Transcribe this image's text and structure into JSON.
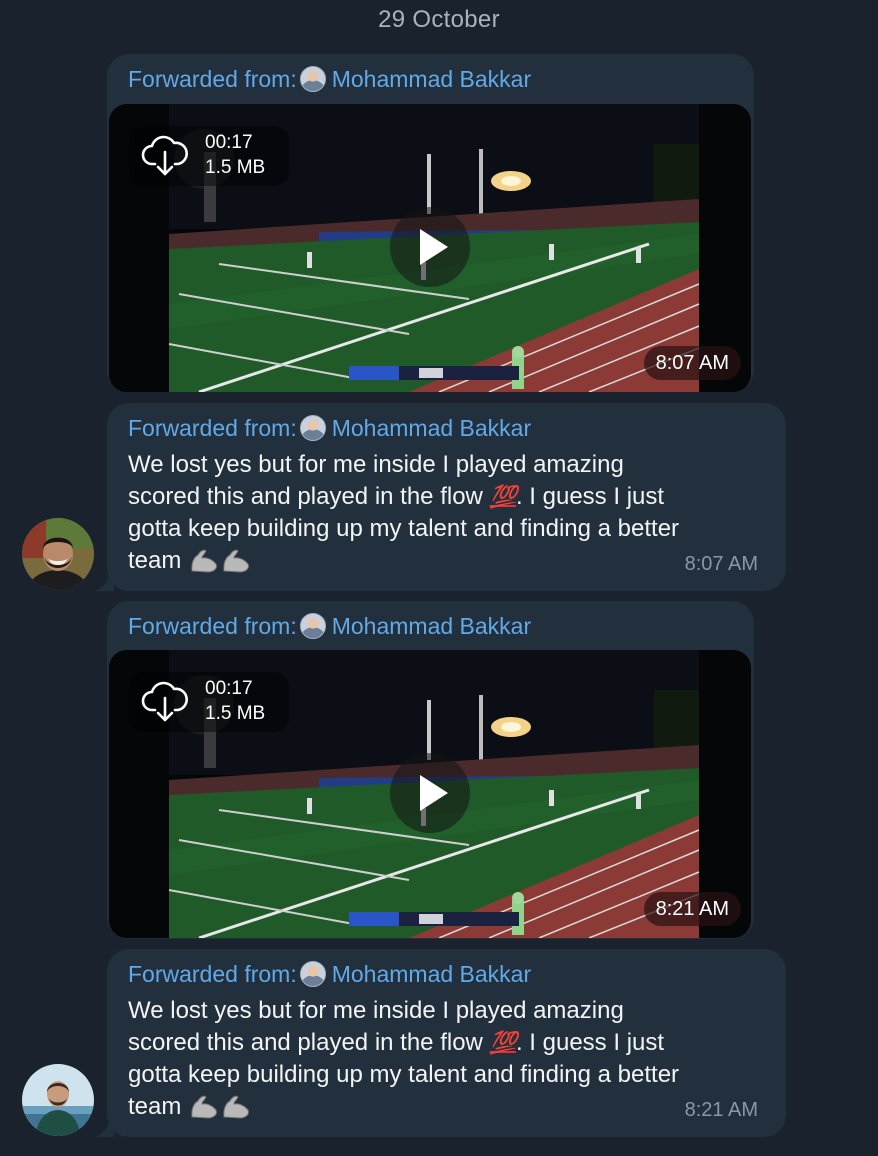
{
  "date_separator": "29 October",
  "messages": [
    {
      "forwarded_label": "Forwarded from:",
      "forwarded_name": "Mohammad Bakkar",
      "video": {
        "duration": "00:17",
        "size": "1.5 MB",
        "time": "8:07 AM"
      }
    },
    {
      "forwarded_label": "Forwarded from:",
      "forwarded_name": "Mohammad Bakkar",
      "text_line1": "We lost yes but for me inside I played amazing",
      "text_line2_a": "scored this and played in the flow",
      "text_line2_emoji": "💯",
      "text_line2_b": ". I guess I just",
      "text_line3": "gotta keep building up my talent and finding a better",
      "text_line4": "team",
      "text_emoji_arms": "💪💪",
      "time": "8:07 AM"
    },
    {
      "forwarded_label": "Forwarded from:",
      "forwarded_name": "Mohammad Bakkar",
      "video": {
        "duration": "00:17",
        "size": "1.5 MB",
        "time": "8:21 AM"
      }
    },
    {
      "forwarded_label": "Forwarded from:",
      "forwarded_name": "Mohammad Bakkar",
      "text_line1": "We lost yes but for me inside I played amazing",
      "text_line2_a": "scored this and played in the flow",
      "text_line2_emoji": "💯",
      "text_line2_b": ". I guess I just",
      "text_line3": "gotta keep building up my talent and finding a better",
      "text_line4": "team",
      "text_emoji_arms": "💪💪",
      "time": "8:21 AM"
    }
  ],
  "icons": {
    "download": "cloud-download-icon",
    "play": "play-icon",
    "emoji_100": "hundred-points-emoji",
    "emoji_arm": "flexed-biceps-emoji"
  },
  "colors": {
    "background": "#19222d",
    "bubble": "#222f3d",
    "link": "#62a9e8",
    "meta": "#8a97a5"
  }
}
